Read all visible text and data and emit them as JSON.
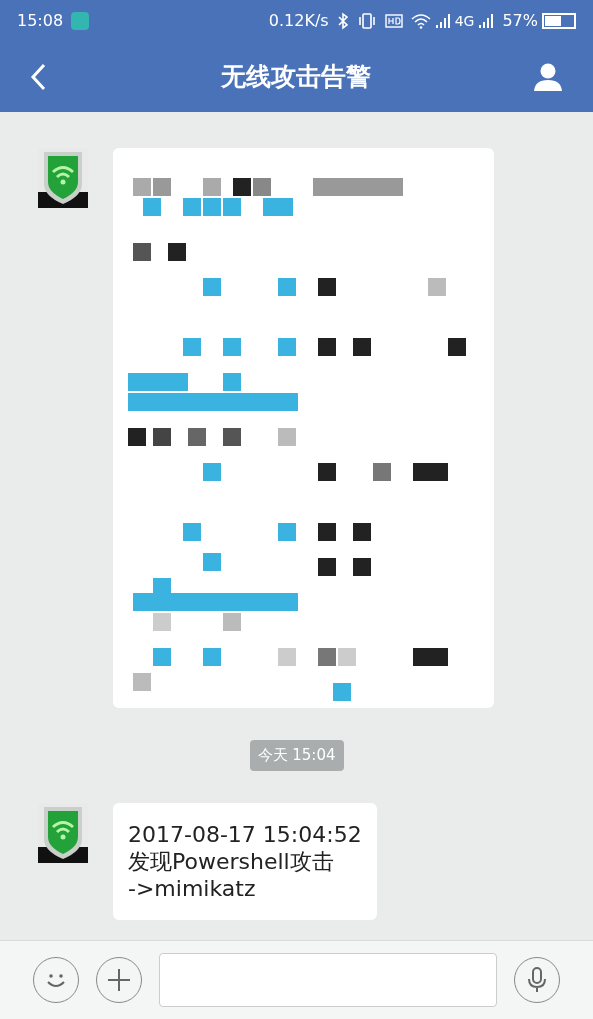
{
  "status_bar": {
    "time": "15:08",
    "speed": "0.12K/s",
    "network": "4G",
    "battery": "57%"
  },
  "header": {
    "title": "无线攻击告警"
  },
  "messages": [
    {
      "kind": "redacted"
    },
    {
      "kind": "time",
      "text": "今天 15:04"
    },
    {
      "kind": "text",
      "lines": [
        "2017-08-17 15:04:52",
        "发现Powershell攻击",
        "->mimikatz"
      ]
    }
  ]
}
